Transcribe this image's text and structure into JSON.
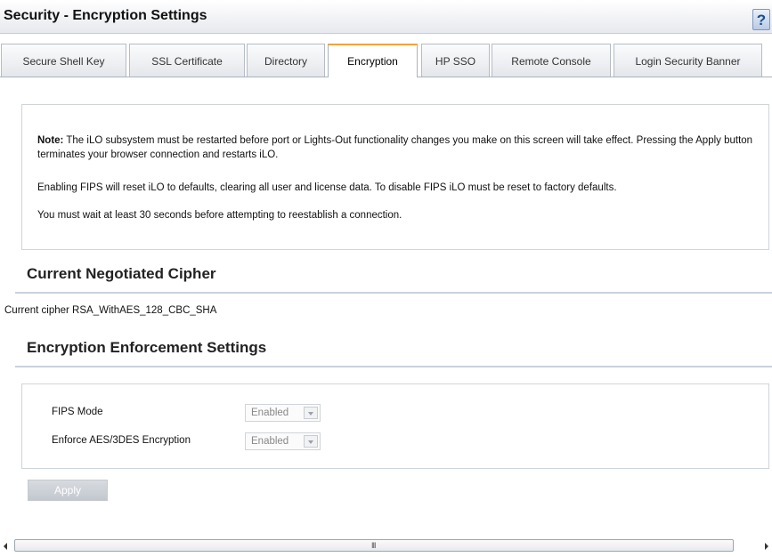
{
  "window": {
    "title": "Security - Encryption Settings",
    "help_label": "?"
  },
  "tabs": [
    {
      "label": "Secure Shell Key",
      "active": false
    },
    {
      "label": "SSL Certificate",
      "active": false
    },
    {
      "label": "Directory",
      "active": false
    },
    {
      "label": "Encryption",
      "active": true
    },
    {
      "label": "HP SSO",
      "active": false
    },
    {
      "label": "Remote Console",
      "active": false
    },
    {
      "label": "Login Security Banner",
      "active": false
    }
  ],
  "note": {
    "bold_prefix": "Note:",
    "line1": " The iLO subsystem must be restarted before port or Lights-Out functionality changes you make on this screen will take effect. Pressing the Apply button terminates your browser connection and restarts iLO.",
    "line2": "Enabling FIPS will reset iLO to defaults, clearing all user and license data. To disable FIPS iLO must be reset to factory defaults.",
    "line3": "You must wait at least 30 seconds before attempting to reestablish a connection."
  },
  "cipher_section": {
    "heading": "Current Negotiated Cipher",
    "text": "Current cipher RSA_WithAES_128_CBC_SHA"
  },
  "enforcement_section": {
    "heading": "Encryption Enforcement Settings",
    "fips_label": "FIPS Mode",
    "fips_value": "Enabled",
    "aes_label": "Enforce AES/3DES Encryption",
    "aes_value": "Enabled"
  },
  "apply_label": "Apply",
  "scrollbar": {
    "grip": "III"
  },
  "colors": {
    "active_tab_accent": "#f0a33d",
    "help_icon": "#1b4d8c"
  }
}
